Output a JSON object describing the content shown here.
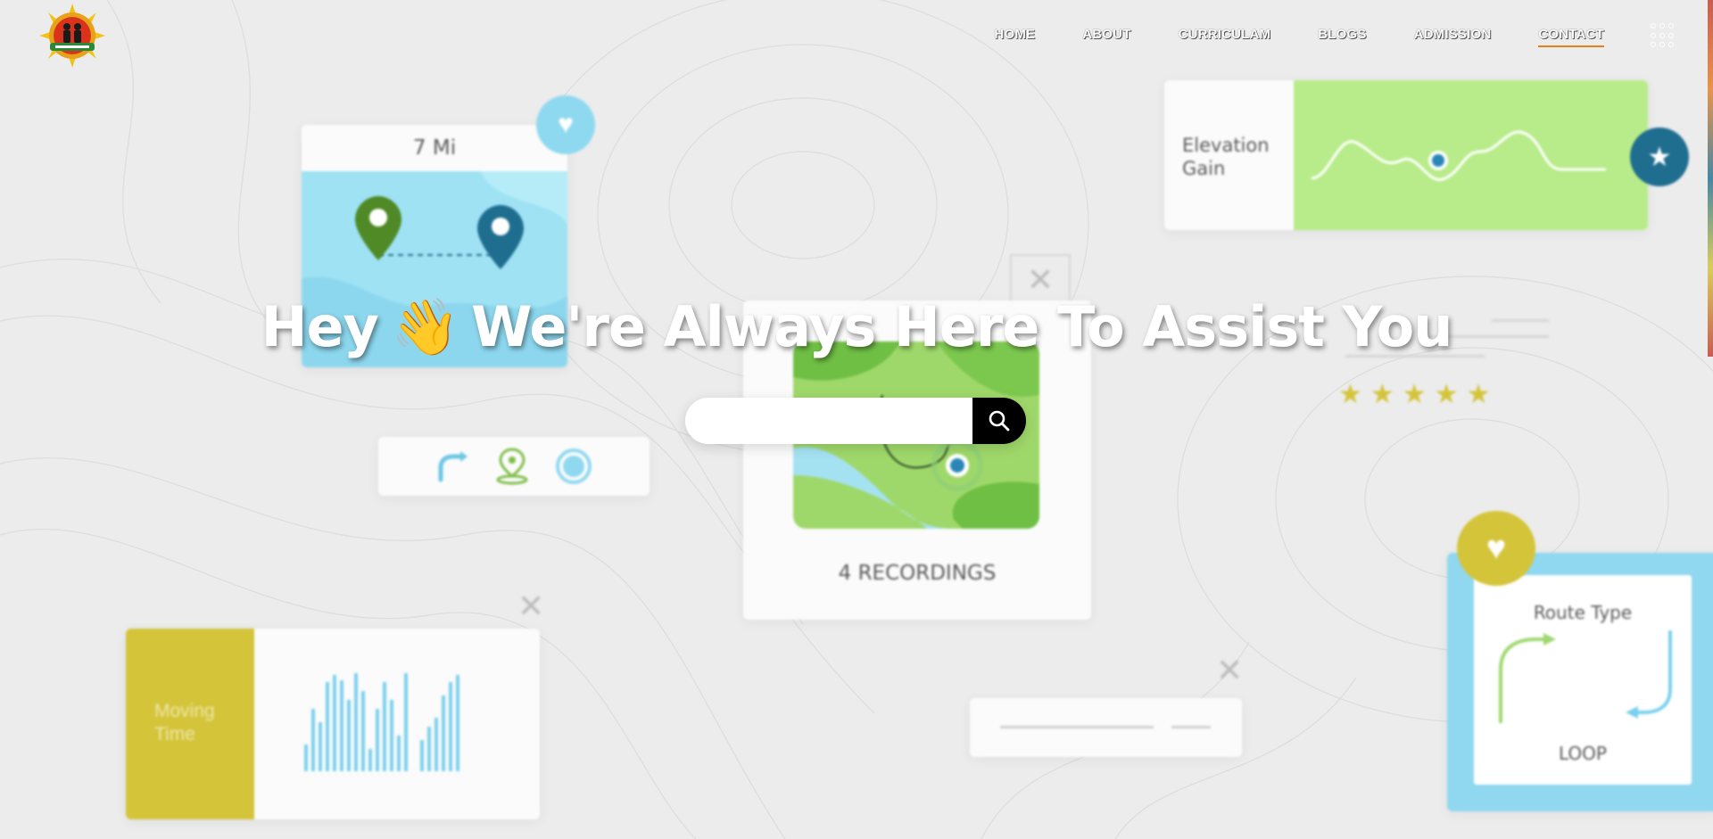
{
  "nav": {
    "items": [
      {
        "label": "HOME",
        "active": false
      },
      {
        "label": "ABOUT",
        "active": false
      },
      {
        "label": "CURRICULAM",
        "active": false
      },
      {
        "label": "BLOGS",
        "active": false
      },
      {
        "label": "ADMISSION",
        "active": false
      },
      {
        "label": "CONTACT",
        "active": true
      }
    ],
    "menu_icon": "grid-dots-icon",
    "active_underline_color": "#e97e1e"
  },
  "hero": {
    "title_before": "Hey",
    "emoji": "👋",
    "title_after": "We're Always Here To Assist You"
  },
  "search": {
    "placeholder": "",
    "value": "",
    "button_icon": "search-icon"
  },
  "background": {
    "distance_card": {
      "label": "7 Mi"
    },
    "elevation_card": {
      "label": "Elevation Gain"
    },
    "recordings_card": {
      "label": "4 RECORDINGS"
    },
    "moving_card": {
      "label": "Moving Time"
    },
    "route_card": {
      "title": "Route Type",
      "subtitle": "LOOP"
    },
    "colors": {
      "sky": "#9ee2f4",
      "green": "#b8ec8a",
      "mustard": "#d4c43a",
      "teal": "#1f6e8f"
    }
  }
}
